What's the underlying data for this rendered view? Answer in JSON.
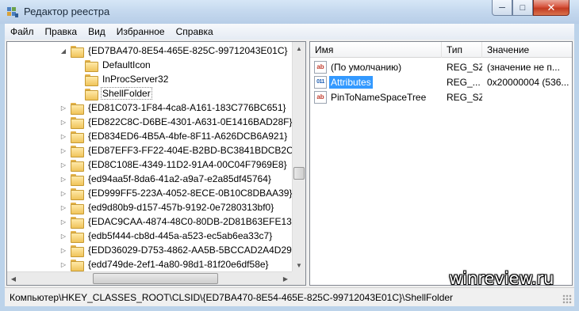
{
  "window": {
    "title": "Редактор реестра",
    "controls": {
      "minimize": "─",
      "maximize": "□",
      "close": "✕"
    },
    "icon": "regedit-icon"
  },
  "menu": [
    "Файл",
    "Правка",
    "Вид",
    "Избранное",
    "Справка"
  ],
  "tree": {
    "items": [
      {
        "label": "{ED7BA470-8E54-465E-825C-99712043E01C}",
        "level": 0,
        "expander": "◢",
        "selected": false
      },
      {
        "label": "DefaultIcon",
        "level": 1,
        "expander": "",
        "selected": false
      },
      {
        "label": "InProcServer32",
        "level": 1,
        "expander": "",
        "selected": false
      },
      {
        "label": "ShellFolder",
        "level": 1,
        "expander": "",
        "selected": true
      },
      {
        "label": "{ED81C073-1F84-4ca8-A161-183C776BC651}",
        "level": 0,
        "expander": "▷",
        "selected": false
      },
      {
        "label": "{ED822C8C-D6BE-4301-A631-0E1416BAD28F}",
        "level": 0,
        "expander": "▷",
        "selected": false
      },
      {
        "label": "{ED834ED6-4B5A-4bfe-8F11-A626DCB6A921}",
        "level": 0,
        "expander": "▷",
        "selected": false
      },
      {
        "label": "{ED87EFF3-FF22-404E-B2BD-BC3841BDCB2C}",
        "level": 0,
        "expander": "▷",
        "selected": false
      },
      {
        "label": "{ED8C108E-4349-11D2-91A4-00C04F7969E8}",
        "level": 0,
        "expander": "▷",
        "selected": false
      },
      {
        "label": "{ed94aa5f-8da6-41a2-a9a7-e2a85df45764}",
        "level": 0,
        "expander": "▷",
        "selected": false
      },
      {
        "label": "{ED999FF5-223A-4052-8ECE-0B10C8DBAA39}",
        "level": 0,
        "expander": "▷",
        "selected": false
      },
      {
        "label": "{ed9d80b9-d157-457b-9192-0e7280313bf0}",
        "level": 0,
        "expander": "▷",
        "selected": false
      },
      {
        "label": "{EDAC9CAA-4874-48C0-80DB-2D81B63EFE13}",
        "level": 0,
        "expander": "▷",
        "selected": false
      },
      {
        "label": "{edb5f444-cb8d-445a-a523-ec5ab6ea33c7}",
        "level": 0,
        "expander": "▷",
        "selected": false
      },
      {
        "label": "{EDD36029-D753-4862-AA5B-5BCCAD2A4D29}",
        "level": 0,
        "expander": "▷",
        "selected": false
      },
      {
        "label": "{edd749de-2ef1-4a80-98d1-81f20e6df58e}",
        "level": 0,
        "expander": "▷",
        "selected": false
      }
    ]
  },
  "list": {
    "columns": [
      "Имя",
      "Тип",
      "Значение"
    ],
    "rows": [
      {
        "name": "(По умолчанию)",
        "type": "REG_SZ",
        "data": "(значение не п...",
        "icon": "string-value-icon",
        "icon_text": "ab",
        "selected": false
      },
      {
        "name": "Attributes",
        "type": "REG_...",
        "data": "0x20000004 (536...",
        "icon": "binary-value-icon",
        "icon_text": "011",
        "selected": true
      },
      {
        "name": "PinToNameSpaceTree",
        "type": "REG_SZ",
        "data": "",
        "icon": "string-value-icon",
        "icon_text": "ab",
        "selected": false
      }
    ]
  },
  "statusbar": {
    "path": "Компьютер\\HKEY_CLASSES_ROOT\\CLSID\\{ED7BA470-8E54-465E-825C-99712043E01C}\\ShellFolder"
  },
  "watermark": "winreview.ru",
  "colors": {
    "selection": "#3399ff",
    "titlebar": "#c4d8ee"
  }
}
